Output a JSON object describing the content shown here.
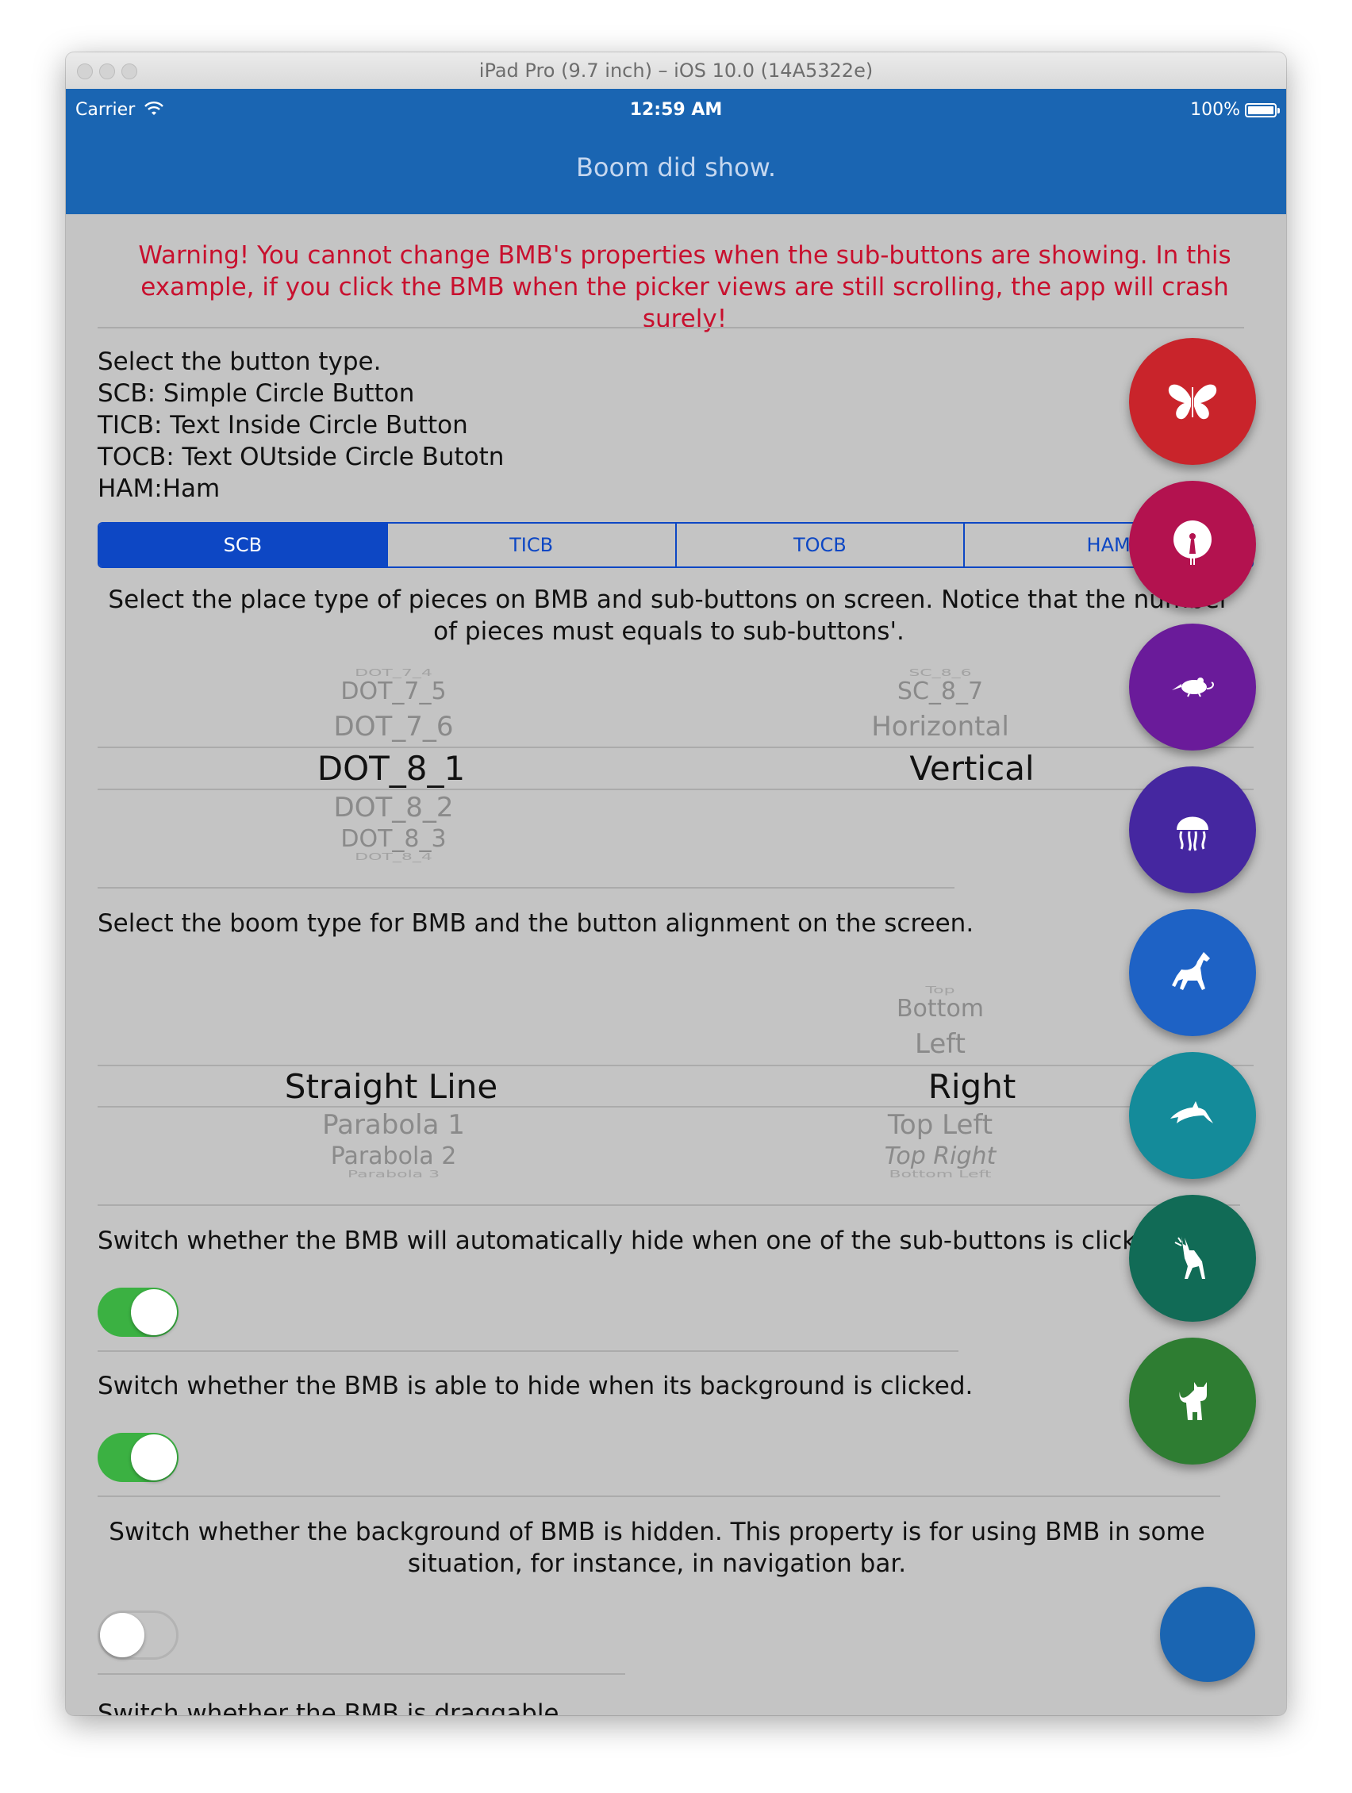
{
  "window": {
    "title": "iPad Pro (9.7 inch) – iOS 10.0 (14A5322e)"
  },
  "status_bar": {
    "carrier": "Carrier",
    "time": "12:59 AM",
    "battery": "100%"
  },
  "nav": {
    "title": "Boom did show."
  },
  "warning": "Warning! You cannot change BMB's properties when the sub-buttons are showing. In this example, if you click the BMB when the picker views are still scrolling, the app will crash surely!",
  "button_type": {
    "lines": [
      "Select the button type.",
      "SCB: Simple Circle Button",
      "TICB: Text Inside Circle Button",
      "TOCB: Text OUtside Circle Butotn",
      "HAM:Ham"
    ],
    "segments": [
      "SCB",
      "TICB",
      "TOCB",
      "HAM"
    ],
    "selected": "SCB"
  },
  "place_type": {
    "description": "Select the place type of pieces on BMB and sub-buttons on screen. Notice that the number of pieces must equals to sub-buttons'.",
    "piece_picker": {
      "above": [
        "DOT_7_4",
        "DOT_7_5",
        "DOT_7_6"
      ],
      "selected": "DOT_8_1",
      "below": [
        "DOT_8_2",
        "DOT_8_3",
        "DOT_8_4"
      ]
    },
    "button_picker": {
      "above": [
        "SC_8_6",
        "SC_8_7",
        "Horizontal"
      ],
      "selected": "Vertical",
      "below": []
    }
  },
  "boom_type": {
    "description": "Select the boom type for BMB and the button alignment on the screen.",
    "boom_picker": {
      "above": [],
      "selected": "Straight Line",
      "below": [
        "Parabola 1",
        "Parabola 2",
        "Parabola 3"
      ]
    },
    "alignment_picker": {
      "above": [
        "Top",
        "Bottom",
        "Left"
      ],
      "selected": "Right",
      "below": [
        "Top Left",
        "Top Right",
        "Bottom Left"
      ]
    }
  },
  "switches": {
    "auto_hide": {
      "label": "Switch whether the BMB will automatically hide when one of the sub-buttons is clicked.",
      "on": true
    },
    "background_hide": {
      "label": "Switch whether the BMB is able to hide when its background is clicked.",
      "on": true
    },
    "background_hidden": {
      "label": "Switch whether the background of BMB is hidden. This property is for using BMB in some situation, for instance, in navigation bar.",
      "on": false
    },
    "draggable": {
      "label": "Switch whether the BMB is draggable."
    }
  },
  "sub_buttons": [
    {
      "icon": "butterfly-icon",
      "color": "#c9242b"
    },
    {
      "icon": "peacock-icon",
      "color": "#b3124f"
    },
    {
      "icon": "rat-icon",
      "color": "#6a1b9a"
    },
    {
      "icon": "jellyfish-icon",
      "color": "#4527a0"
    },
    {
      "icon": "horse-icon",
      "color": "#1e62c5"
    },
    {
      "icon": "dolphin-icon",
      "color": "#148b9a"
    },
    {
      "icon": "deer-icon",
      "color": "#116b56"
    },
    {
      "icon": "cat-icon",
      "color": "#2e7d32"
    }
  ],
  "boom_button": {
    "color": "#1a65b2"
  },
  "colors": {
    "nav": "#1a65b2",
    "warning": "#c8102e",
    "segment": "#0d47c4",
    "switch_on": "#3bb142",
    "background": "#c4c4c4"
  }
}
